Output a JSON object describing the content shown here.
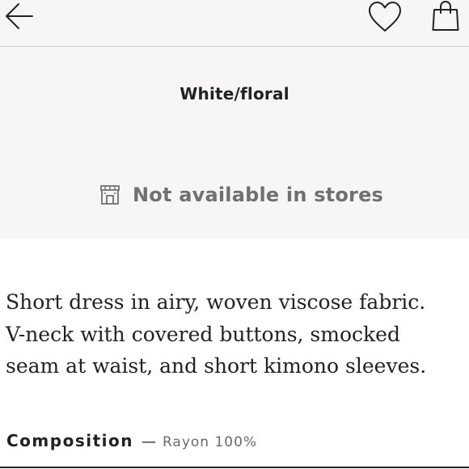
{
  "header": {
    "back_icon": "arrow-left-icon",
    "favorite_icon": "heart-icon",
    "bag_icon": "shopping-bag-icon"
  },
  "product": {
    "color_name": "White/floral",
    "availability": {
      "icon": "store-icon",
      "text": "Not available in stores"
    },
    "description": "Short dress in airy, woven viscose fabric. V-neck with covered buttons, smocked seam at waist, and short kimono sleeves.",
    "composition": {
      "label": "Composition",
      "separator": "—",
      "value": "Rayon 100%"
    }
  },
  "colors": {
    "panel_background": "#f7f5f5",
    "text_primary": "#222222",
    "text_muted": "#707070"
  }
}
